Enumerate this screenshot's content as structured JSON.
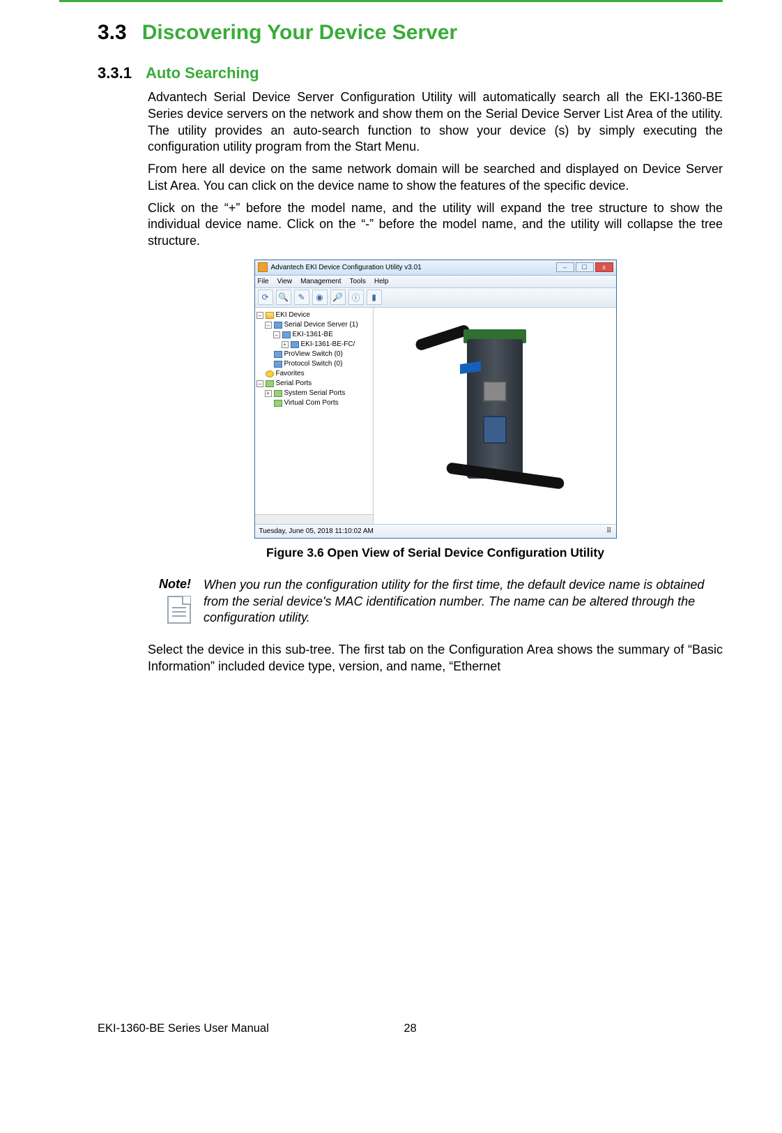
{
  "section": {
    "number": "3.3",
    "title": "Discovering Your Device Server"
  },
  "subsection": {
    "number": "3.3.1",
    "title": "Auto Searching"
  },
  "paragraphs": {
    "p1": "Advantech Serial Device Server Configuration Utility will automatically search all the EKI-1360-BE Series device servers on the network and show them on the Serial Device Server List Area of the utility. The utility provides an auto-search function to show your device (s) by simply executing the configuration utility program from the Start Menu.",
    "p2": "From here all device on the same network domain will be searched and displayed on Device Server List Area. You can click on the device name to show the features of the specific device.",
    "p3": "Click on the “+” before the model name, and the utility will expand the tree structure to show the individual device name. Click on the “-” before the model name, and the utility will collapse the tree structure.",
    "p4": "Select the device in this sub-tree. The first tab on the Configuration Area shows the summary of “Basic Information” included device type, version, and name, “Ethernet"
  },
  "figure": {
    "caption": "Figure 3.6 Open View of Serial Device Configuration Utility"
  },
  "app": {
    "title": "Advantech EKI Device Configuration Utility v3.01",
    "menu": {
      "file": "File",
      "view": "View",
      "management": "Management",
      "tools": "Tools",
      "help": "Help"
    },
    "tree": {
      "root": "EKI Device",
      "sds": "Serial Device Server (1)",
      "model": "EKI-1361-BE",
      "unit": "EKI-1361-BE-FC/",
      "proview": "ProView Switch (0)",
      "protocol": "Protocol Switch (0)",
      "fav": "Favorites",
      "ports": "Serial Ports",
      "sys": "System Serial Ports",
      "vcom": "Virtual Com Ports"
    },
    "status": "Tuesday, June 05, 2018  11:10:02 AM",
    "winbtns": {
      "min": "–",
      "max": "☐",
      "close": "x"
    }
  },
  "note": {
    "label": "Note!",
    "text": "When you run the configuration utility for the first time, the default device name is obtained from the serial device's MAC identification number. The name can be altered through the configuration utility."
  },
  "footer": {
    "left": "EKI-1360-BE Series User Manual",
    "page": "28"
  }
}
